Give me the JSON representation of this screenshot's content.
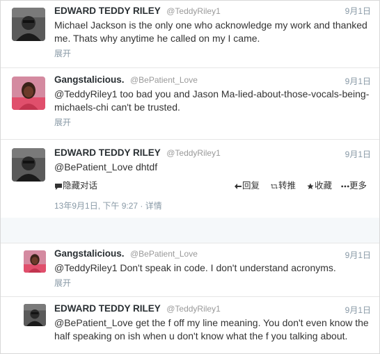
{
  "tweets": [
    {
      "fullname": "EDWARD TEDDY RILEY",
      "username": "@TeddyRiley1",
      "time": "9月1日",
      "text": "Michael Jackson is the only one who acknowledge my work and thanked me. Thats why anytime he called on my I came.",
      "expand": "展开"
    },
    {
      "fullname": "Gangstalicious.",
      "username": "@BePatient_Love",
      "time": "9月1日",
      "text": "@TeddyRiley1 too bad you and Jason Ma-lied-about-those-vocals-being-michaels-chi can't be trusted.",
      "expand": "展开"
    },
    {
      "fullname": "EDWARD TEDDY RILEY",
      "username": "@TeddyRiley1",
      "time": "9月1日",
      "text": "@BePatient_Love dhtdf",
      "hide_conversation": "隐藏对话",
      "reply": "回复",
      "retweet": "转推",
      "favorite": "收藏",
      "more": "更多",
      "timestamp": "13年9月1日, 下午 9:27",
      "details": "· 详情"
    },
    {
      "fullname": "Gangstalicious.",
      "username": "@BePatient_Love",
      "time": "9月1日",
      "text": "@TeddyRiley1 Don't speak in code. I don't understand acronyms.",
      "expand": "展开"
    },
    {
      "fullname": "EDWARD TEDDY RILEY",
      "username": "@TeddyRiley1",
      "time": "9月1日",
      "text": "@BePatient_Love get the f off my line meaning. You don't even know the half speaking on ish when u don't know what the f you talking about."
    }
  ],
  "icons": {
    "reply": "reply-arrow-icon",
    "retweet": "retweet-icon",
    "favorite": "star-icon",
    "more": "ellipsis-icon",
    "conversation": "speech-bubble-icon"
  },
  "colors": {
    "secondary_text": "#8899a6",
    "name_text": "#292f33"
  }
}
